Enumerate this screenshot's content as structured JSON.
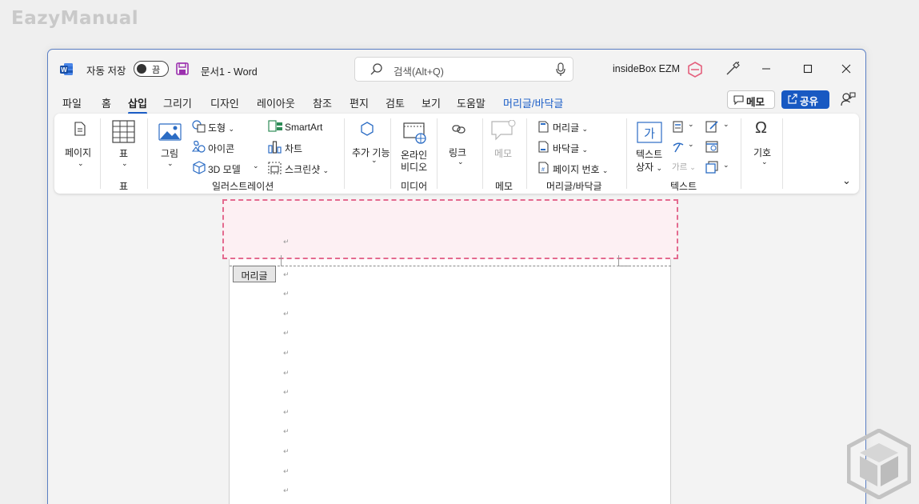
{
  "watermark": "EazyManual",
  "titlebar": {
    "autosave_label": "자동 저장",
    "autosave_state": "끔",
    "doc_title": "문서1  -  Word",
    "search_placeholder": "검색(Alt+Q)",
    "user_name": "insideBox EZM"
  },
  "tabs": [
    {
      "label": "파일"
    },
    {
      "label": "홈"
    },
    {
      "label": "삽입"
    },
    {
      "label": "그리기"
    },
    {
      "label": "디자인"
    },
    {
      "label": "레이아웃"
    },
    {
      "label": "참조"
    },
    {
      "label": "편지"
    },
    {
      "label": "검토"
    },
    {
      "label": "보기"
    },
    {
      "label": "도움말"
    },
    {
      "label": "머리글/바닥글"
    }
  ],
  "header_actions": {
    "memo": "메모",
    "share": "공유"
  },
  "ribbon": {
    "pages": {
      "label": "페이지"
    },
    "table": {
      "label": "표",
      "group": "표"
    },
    "illustrations": {
      "picture": "그림",
      "shapes": "도형",
      "icons": "아이콘",
      "models3d": "3D 모델",
      "smartart": "SmartArt",
      "chart": "차트",
      "screenshot": "스크린샷",
      "group": "일러스트레이션"
    },
    "addins": {
      "label": "추가 기능"
    },
    "media": {
      "online_video_1": "온라인",
      "online_video_2": "비디오",
      "group": "미디어"
    },
    "links": {
      "label": "링크"
    },
    "comments": {
      "label": "메모",
      "group": "메모"
    },
    "header_footer": {
      "header": "머리글",
      "footer": "바닥글",
      "page_number": "페이지 번호",
      "group": "머리글/바닥글"
    },
    "text": {
      "textbox_1": "텍스트",
      "textbox_2": "상자",
      "dropcap": "가르",
      "group": "텍스트"
    },
    "symbols": {
      "label": "기호"
    }
  },
  "document": {
    "header_tag": "머리글",
    "paragraph_mark": "↵"
  },
  "colors": {
    "accent": "#1a5dc7",
    "header_border": "#e46a8f",
    "header_fill": "#fdf0f3"
  }
}
